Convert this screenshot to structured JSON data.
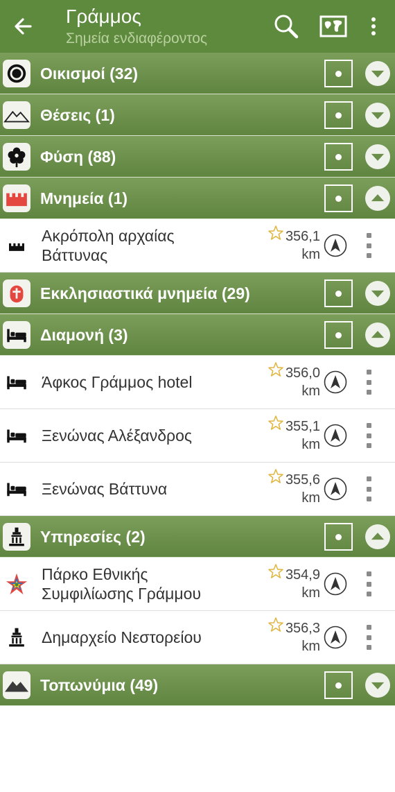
{
  "header": {
    "title": "Γράμμος",
    "subtitle": "Σημεία ενδιαφέροντος",
    "back_icon": "arrow-left-icon",
    "search_icon": "search-icon",
    "map_icon": "map-icon",
    "more_icon": "more-vert-icon"
  },
  "colors": {
    "appbar": "#5e8a3d",
    "category_bar": "#6b8f4b",
    "text_primary": "#333333"
  },
  "categories": [
    {
      "label": "Οικισμοί (32)",
      "icon": "settlement-icon",
      "expanded": false,
      "items": []
    },
    {
      "label": "Θέσεις (1)",
      "icon": "mountain-outline-icon",
      "expanded": false,
      "items": []
    },
    {
      "label": "Φύση (88)",
      "icon": "flower-icon",
      "expanded": false,
      "items": []
    },
    {
      "label": "Μνημεία (1)",
      "icon": "castle-icon",
      "expanded": true,
      "items": [
        {
          "name_line1": "Ακρόπολη αρχαίας",
          "name_line2": "Βάττυνας",
          "dist_value": "356,1",
          "dist_unit": "km",
          "icon": "castle-icon"
        }
      ]
    },
    {
      "label": "Εκκλησιαστικά μνημεία (29)",
      "icon": "church-icon",
      "expanded": false,
      "items": []
    },
    {
      "label": "Διαμονή (3)",
      "icon": "bed-icon",
      "expanded": true,
      "items": [
        {
          "name_line1": "Άφκος Γράμμος hotel",
          "name_line2": "",
          "dist_value": "356,0",
          "dist_unit": "km",
          "icon": "bed-icon"
        },
        {
          "name_line1": "Ξενώνας Αλέξανδρος",
          "name_line2": "",
          "dist_value": "355,1",
          "dist_unit": "km",
          "icon": "bed-icon"
        },
        {
          "name_line1": "Ξενώνας Βάττυνα",
          "name_line2": "",
          "dist_value": "355,6",
          "dist_unit": "km",
          "icon": "bed-icon"
        }
      ]
    },
    {
      "label": "Υπηρεσίες (2)",
      "icon": "town-hall-icon",
      "expanded": true,
      "items": [
        {
          "name_line1": "Πάρκο Εθνικής",
          "name_line2": "Συμφιλίωσης Γράμμου",
          "dist_value": "354,9",
          "dist_unit": "km",
          "icon": "park-star-icon"
        },
        {
          "name_line1": "Δημαρχείο Νεστορείου",
          "name_line2": "",
          "dist_value": "356,3",
          "dist_unit": "km",
          "icon": "town-hall-icon"
        }
      ]
    },
    {
      "label": "Τοπωνύμια (49)",
      "icon": "mountain-filled-icon",
      "expanded": false,
      "items": []
    }
  ]
}
